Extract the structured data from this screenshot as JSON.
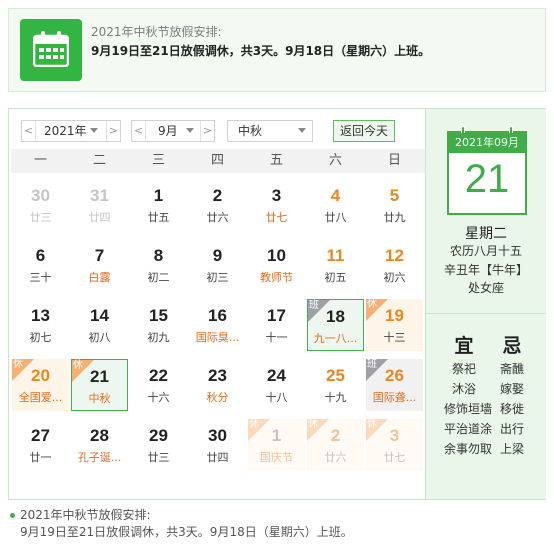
{
  "notice": {
    "title": "2021年中秋节放假安排:",
    "body": "9月19日至21日放假调休，共3天。9月18日（星期六）上班。",
    "icon": "calendar-icon"
  },
  "toolbar": {
    "year": "2021年",
    "month": "9月",
    "holiday": "中秋",
    "today_label": "返回今天",
    "prev": "<",
    "next": ">"
  },
  "weekdays": [
    "一",
    "二",
    "三",
    "四",
    "五",
    "六",
    "日"
  ],
  "days": [
    {
      "n": "30",
      "l": "廿三",
      "other": true
    },
    {
      "n": "31",
      "l": "廿四",
      "other": true
    },
    {
      "n": "1",
      "l": "廿五"
    },
    {
      "n": "2",
      "l": "廿六"
    },
    {
      "n": "3",
      "l": "廿七",
      "fest": true
    },
    {
      "n": "4",
      "l": "廿八",
      "wk": true
    },
    {
      "n": "5",
      "l": "廿九",
      "wk": true
    },
    {
      "n": "6",
      "l": "三十"
    },
    {
      "n": "7",
      "l": "白露",
      "fest": true
    },
    {
      "n": "8",
      "l": "初二"
    },
    {
      "n": "9",
      "l": "初三"
    },
    {
      "n": "10",
      "l": "教师节",
      "fest": true
    },
    {
      "n": "11",
      "l": "初五",
      "wk": true
    },
    {
      "n": "12",
      "l": "初六",
      "wk": true
    },
    {
      "n": "13",
      "l": "初七"
    },
    {
      "n": "14",
      "l": "初八"
    },
    {
      "n": "15",
      "l": "初九"
    },
    {
      "n": "16",
      "l": "国际臭...",
      "fest": true
    },
    {
      "n": "17",
      "l": "十一"
    },
    {
      "n": "18",
      "l": "九一八...",
      "fest": true,
      "wk": true,
      "tag": "班",
      "type": "work",
      "boxed": true
    },
    {
      "n": "19",
      "l": "十三",
      "wk": true,
      "tag": "休",
      "type": "rest"
    },
    {
      "n": "20",
      "l": "全国爱...",
      "fest": true,
      "tag": "休",
      "type": "rest",
      "redNum": true
    },
    {
      "n": "21",
      "l": "中秋",
      "fest": true,
      "tag": "休",
      "type": "today"
    },
    {
      "n": "22",
      "l": "十六"
    },
    {
      "n": "23",
      "l": "秋分",
      "fest": true
    },
    {
      "n": "24",
      "l": "十八"
    },
    {
      "n": "25",
      "l": "十九",
      "wk": true
    },
    {
      "n": "26",
      "l": "国际聋...",
      "fest": true,
      "wk": true,
      "tag": "班",
      "type": "work"
    },
    {
      "n": "27",
      "l": "廿一"
    },
    {
      "n": "28",
      "l": "孔子诞...",
      "fest": true
    },
    {
      "n": "29",
      "l": "廿三"
    },
    {
      "n": "30",
      "l": "廿四"
    },
    {
      "n": "1",
      "l": "国庆节",
      "fest": true,
      "other": true,
      "tag": "休",
      "type": "rest"
    },
    {
      "n": "2",
      "l": "廿六",
      "other": true,
      "wk": true,
      "tag": "休",
      "type": "rest"
    },
    {
      "n": "3",
      "l": "廿七",
      "other": true,
      "wk": true,
      "tag": "休",
      "type": "rest"
    }
  ],
  "side": {
    "header": "2021年09月",
    "day": "21",
    "weekday": "星期二",
    "lunar": "农历八月十五",
    "ganzhi": "辛丑年【牛年】",
    "zodiac": "处女座",
    "yi_title": "宜",
    "ji_title": "忌",
    "yi": [
      "祭祀",
      "沐浴",
      "修饰垣墙",
      "平治道涂",
      "余事勿取"
    ],
    "ji": [
      "斋醮",
      "嫁娶",
      "移徙",
      "出行",
      "上梁"
    ]
  },
  "footer": {
    "title": "2021年中秋节放假安排:",
    "body": "9月19日至21日放假调休，共3天。9月18日（星期六）上班。"
  }
}
